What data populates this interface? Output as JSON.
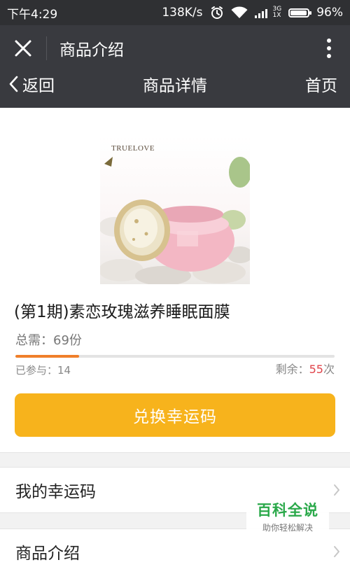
{
  "status_bar": {
    "time": "下午4:29",
    "speed": "138K/s",
    "network_top": "3G",
    "network_bottom": "1X",
    "battery_percent": "96%",
    "battery_level": 0.96,
    "icons": [
      "alarm-icon",
      "wifi-icon",
      "signal-icon",
      "battery-icon"
    ]
  },
  "top_nav": {
    "title": "商品介绍",
    "icons": [
      "close-icon",
      "more-vertical-icon"
    ]
  },
  "sub_nav": {
    "back_label": "返回",
    "title": "商品详情",
    "home_label": "首页"
  },
  "product": {
    "brand_text": "TRUELOVE",
    "title": "(第1期)素恋玫瑰滋养睡眠面膜",
    "total_need": "总需：69份",
    "participated": "已参与：14",
    "remaining_prefix": "剩余：",
    "remaining_value": "55",
    "remaining_suffix": "次",
    "progress_fraction": 0.2
  },
  "actions": {
    "redeem_label": "兑换幸运码"
  },
  "list": {
    "my_lucky_codes": "我的幸运码",
    "product_intro": "商品介绍"
  },
  "watermark": {
    "title": "百科全说",
    "subtitle": "助你轻松解决"
  },
  "colors": {
    "status_bg": "#2f3033",
    "nav_bg": "#393a3f",
    "accent_button": "#f7b31c",
    "progress": "#f07f2a",
    "remaining_number": "#e0434a",
    "watermark_green": "#2aa94a"
  }
}
